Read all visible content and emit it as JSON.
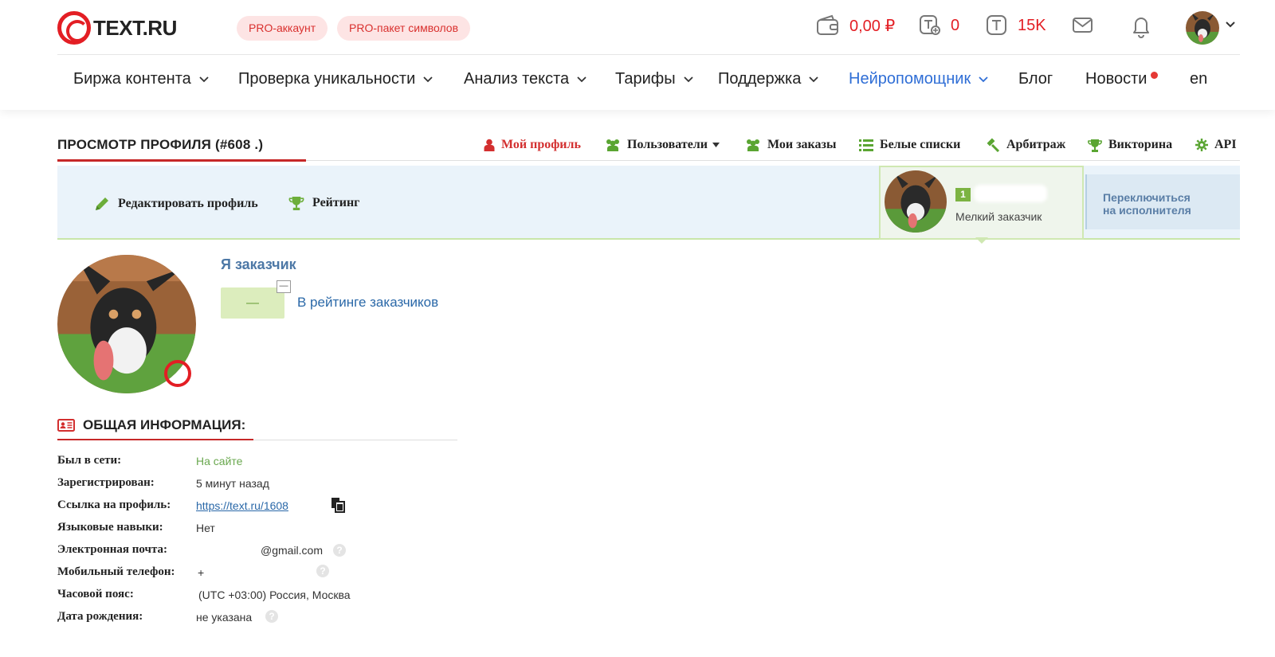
{
  "header": {
    "logo_text": "TEXT.RU",
    "pro_account": "PRO-аккаунт",
    "pro_package": "PRO-пакет символов",
    "balance": "0,00 ₽",
    "orders_count": "0",
    "symbols": "15K",
    "icons": [
      "wallet-icon",
      "tasks-icon",
      "symbols-icon",
      "mail-icon",
      "bell-icon"
    ]
  },
  "nav": {
    "items": [
      {
        "label": "Биржа контента"
      },
      {
        "label": "Проверка уникальности"
      },
      {
        "label": "Анализ текста"
      },
      {
        "label": "Тарифы"
      },
      {
        "label": "Поддержка"
      },
      {
        "label": "Нейропомощник"
      },
      {
        "label": "Блог"
      },
      {
        "label": "Новости"
      },
      {
        "label": "en"
      }
    ]
  },
  "profile_header": {
    "title": "ПРОСМОТР ПРОФИЛЯ (#608        .)",
    "tabs": [
      {
        "label": "Мой профиль"
      },
      {
        "label": "Пользователи"
      },
      {
        "label": "Мои заказы"
      },
      {
        "label": "Белые списки"
      },
      {
        "label": "Арбитраж"
      },
      {
        "label": "Викторина"
      },
      {
        "label": "API"
      }
    ]
  },
  "band": {
    "edit_profile": "Редактировать профиль",
    "rating": "Рейтинг",
    "level": "1",
    "role": "Мелкий заказчик",
    "switch_line1": "Переключиться",
    "switch_line2": "на исполнителя"
  },
  "profile": {
    "role_title": "Я заказчик",
    "rating_value": "—",
    "rating_mini": "—",
    "rating_link": "В рейтинге заказчиков"
  },
  "general": {
    "title": "ОБЩАЯ ИНФОРМАЦИЯ:",
    "rows": [
      {
        "label": "Был в сети:",
        "value": "На сайте"
      },
      {
        "label": "Зарегистрирован:",
        "value": "5 минут назад"
      },
      {
        "label": "Ссылка на профиль:",
        "value": "https://text.ru/1608"
      },
      {
        "label": "Языковые навыки:",
        "value": "Нет"
      },
      {
        "label": "Электронная почта:",
        "value": "@gmail.com"
      },
      {
        "label": "Мобильный телефон:",
        "value": "+"
      },
      {
        "label": "Часовой пояс:",
        "value": "(UTC +03:00) Россия, Москва"
      },
      {
        "label": "Дата рождения:",
        "value": "не указана"
      }
    ]
  },
  "colors": {
    "brand_red": "#e31e24",
    "accent_blue": "#2f6ed6",
    "online_green": "#6aa84f",
    "band_bg": "#eaf3fa"
  }
}
